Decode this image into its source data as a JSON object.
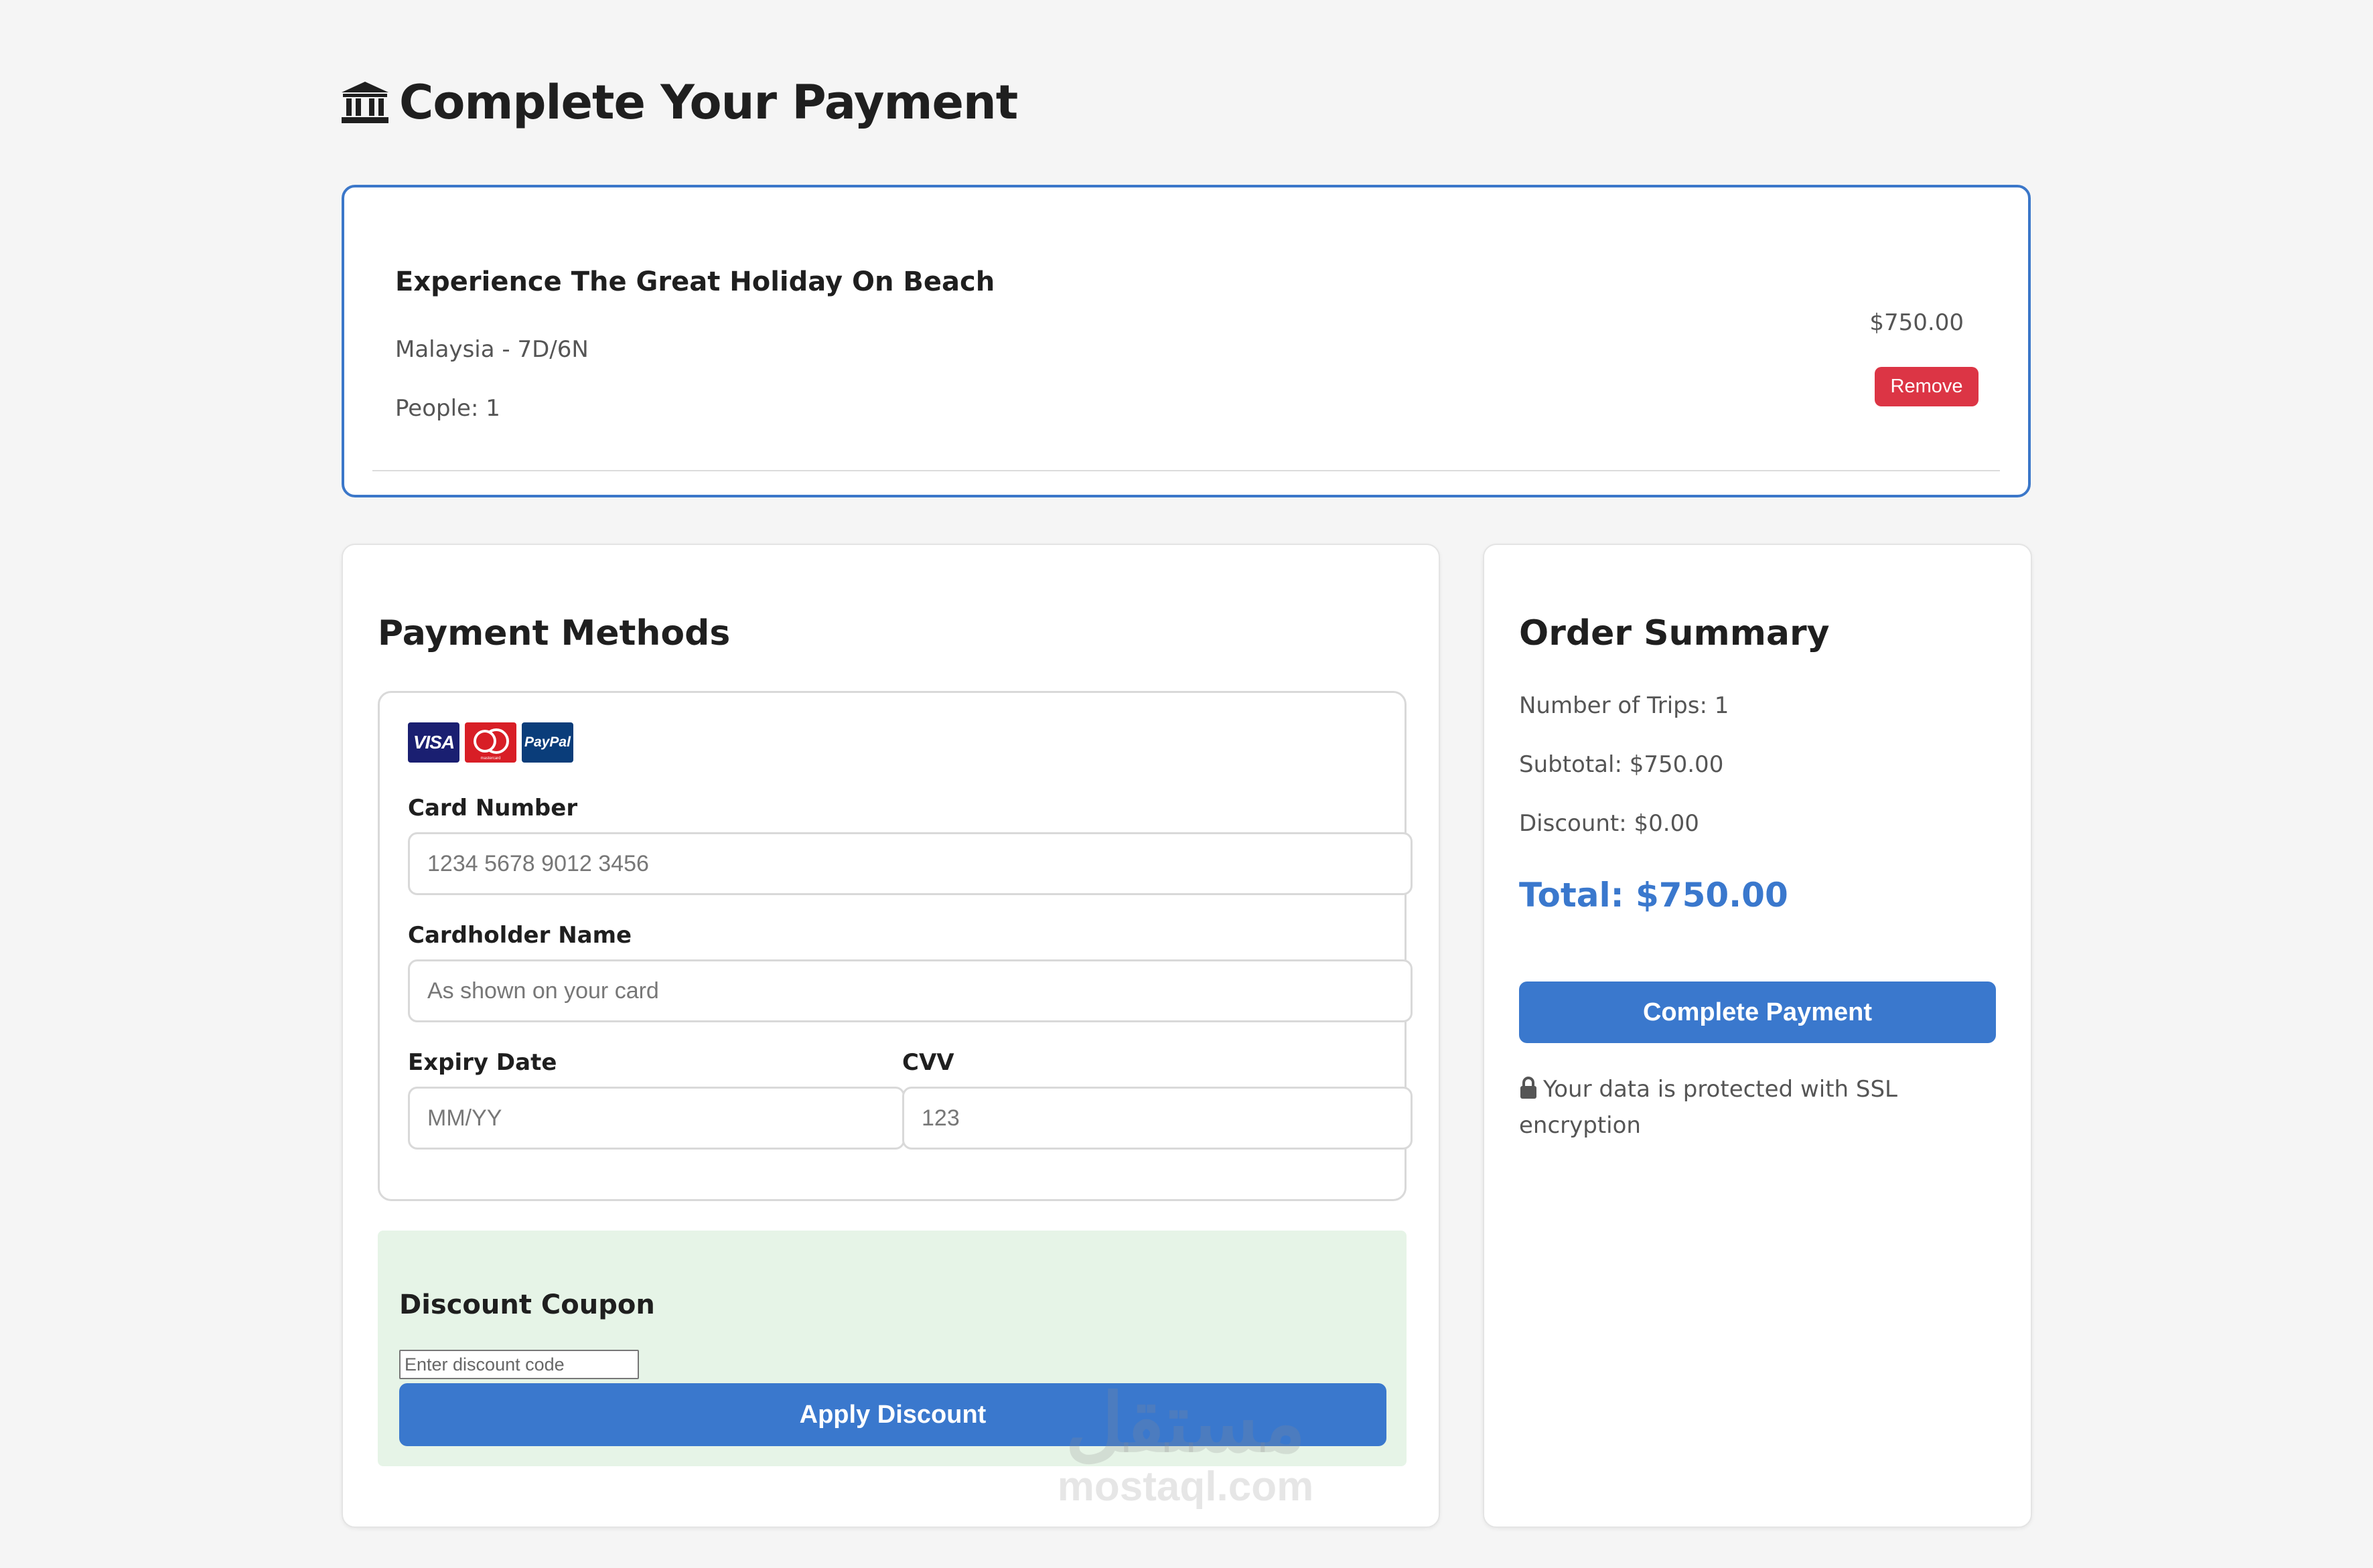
{
  "header": {
    "title": "Complete Your Payment",
    "icon": "bank-icon"
  },
  "cart": {
    "trip_title": "Experience The Great Holiday On Beach",
    "location": "Malaysia - 7D/6N",
    "people": "People: 1",
    "price": "$750.00",
    "remove_label": "Remove"
  },
  "payment": {
    "heading": "Payment Methods",
    "logos": {
      "visa": "VISA",
      "mastercard": "mastercard",
      "paypal": "PayPal"
    },
    "card_number": {
      "label": "Card Number",
      "placeholder": "1234 5678 9012 3456",
      "value": ""
    },
    "cardholder": {
      "label": "Cardholder Name",
      "placeholder": "As shown on your card",
      "value": ""
    },
    "expiry": {
      "label": "Expiry Date",
      "placeholder": "MM/YY",
      "value": ""
    },
    "cvv": {
      "label": "CVV",
      "placeholder": "123",
      "value": ""
    }
  },
  "coupon": {
    "heading": "Discount Coupon",
    "placeholder": "Enter discount code",
    "value": "",
    "apply_label": "Apply Discount"
  },
  "summary": {
    "heading": "Order Summary",
    "trips": "Number of Trips: 1",
    "subtotal": "Subtotal: $750.00",
    "discount": "Discount: $0.00",
    "total": "Total: $750.00",
    "pay_label": "Complete Payment",
    "ssl_note": "Your data is protected with SSL encryption"
  },
  "watermark": {
    "arabic": "مستقل",
    "latin": "mostaql.com"
  },
  "colors": {
    "primary": "#3a78cd",
    "danger": "#dc3545",
    "coupon_bg": "#e6f4e7",
    "page_bg": "#f5f5f5"
  }
}
